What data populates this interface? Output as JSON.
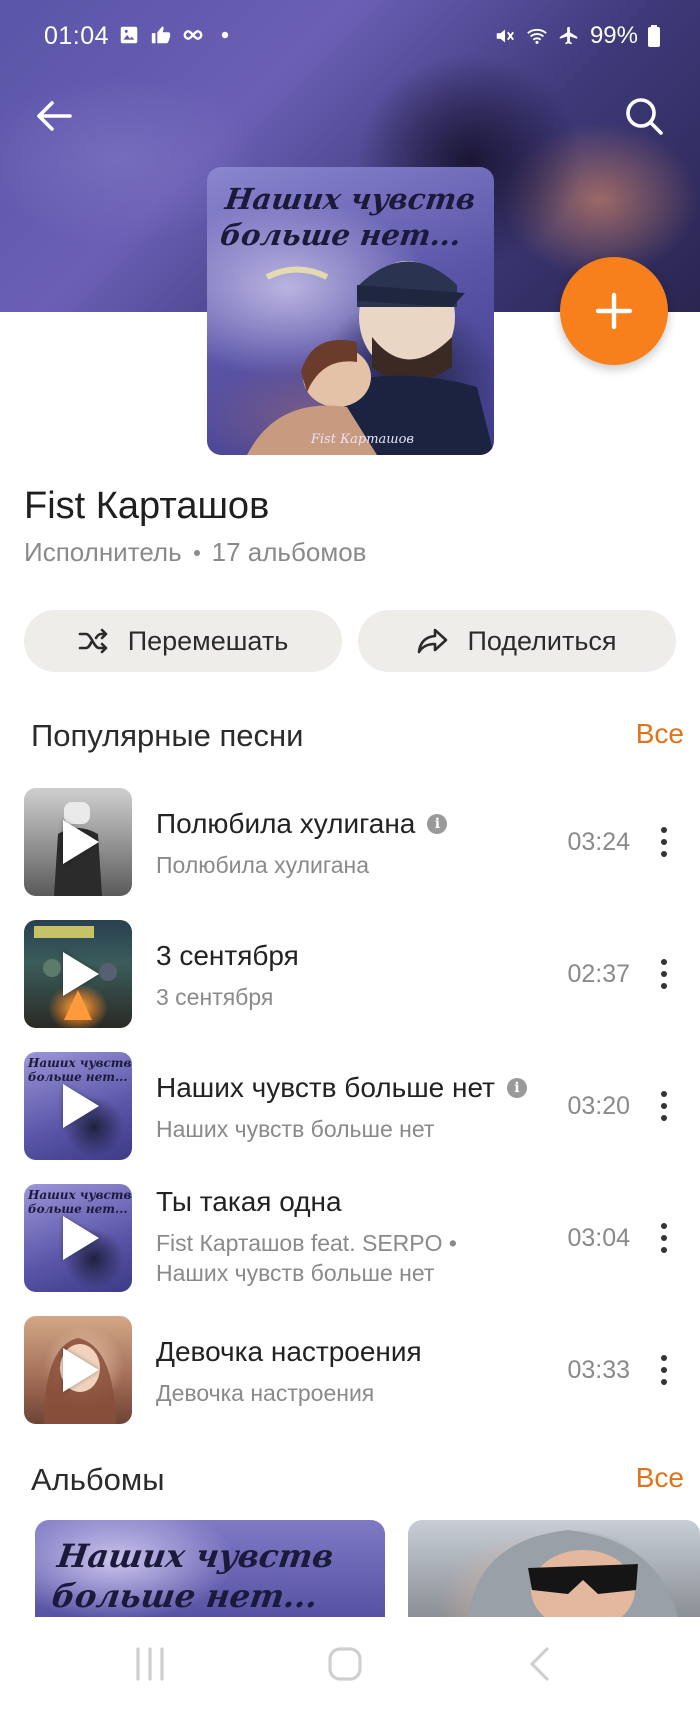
{
  "status_bar": {
    "time": "01:04",
    "battery": "99%",
    "left_icons": [
      "image-icon",
      "thumbs-up-icon",
      "infinity-icon",
      "dot-icon"
    ],
    "right_icons": [
      "mute-icon",
      "wifi-icon",
      "airplane-icon",
      "battery-icon"
    ]
  },
  "header": {
    "back_icon": "arrow-left-icon",
    "search_icon": "search-icon",
    "add_icon": "plus-icon",
    "accent_color": "#f7801c"
  },
  "cover": {
    "title_line1": "Наших чувств",
    "title_line2": "больше нет...",
    "signature": "Fist Карташов"
  },
  "artist": {
    "name": "Fist Карташов",
    "type": "Исполнитель",
    "albums_count": "17 альбомов"
  },
  "actions": {
    "shuffle_label": "Перемешать",
    "share_label": "Поделиться"
  },
  "popular": {
    "title": "Популярные песни",
    "all_label": "Все",
    "songs": [
      {
        "title": "Полюбила хулигана",
        "subtitle": "Полюбила хулигана",
        "duration": "03:24",
        "info": true
      },
      {
        "title": "3 сентября",
        "subtitle": "3 сентября",
        "duration": "02:37",
        "info": false
      },
      {
        "title": "Наших чувств больше нет",
        "subtitle": "Наших чувств больше нет",
        "duration": "03:20",
        "info": true
      },
      {
        "title": "Ты такая одна",
        "subtitle_line1": "Fist Карташов feat. SERPO •",
        "subtitle_line2": "Наших чувств больше нет",
        "duration": "03:04",
        "info": false
      },
      {
        "title": "Девочка настроения",
        "subtitle": "Девочка настроения",
        "duration": "03:33",
        "info": false
      }
    ]
  },
  "albums": {
    "title": "Альбомы",
    "all_label": "Все",
    "items": [
      {
        "title_line1": "Наших чувств",
        "title_line2": "больше нет..."
      },
      {
        "title_line1": ""
      }
    ]
  },
  "info_glyph": "i",
  "navbar": {
    "icons": [
      "recent-apps-icon",
      "home-icon",
      "back-icon"
    ]
  }
}
